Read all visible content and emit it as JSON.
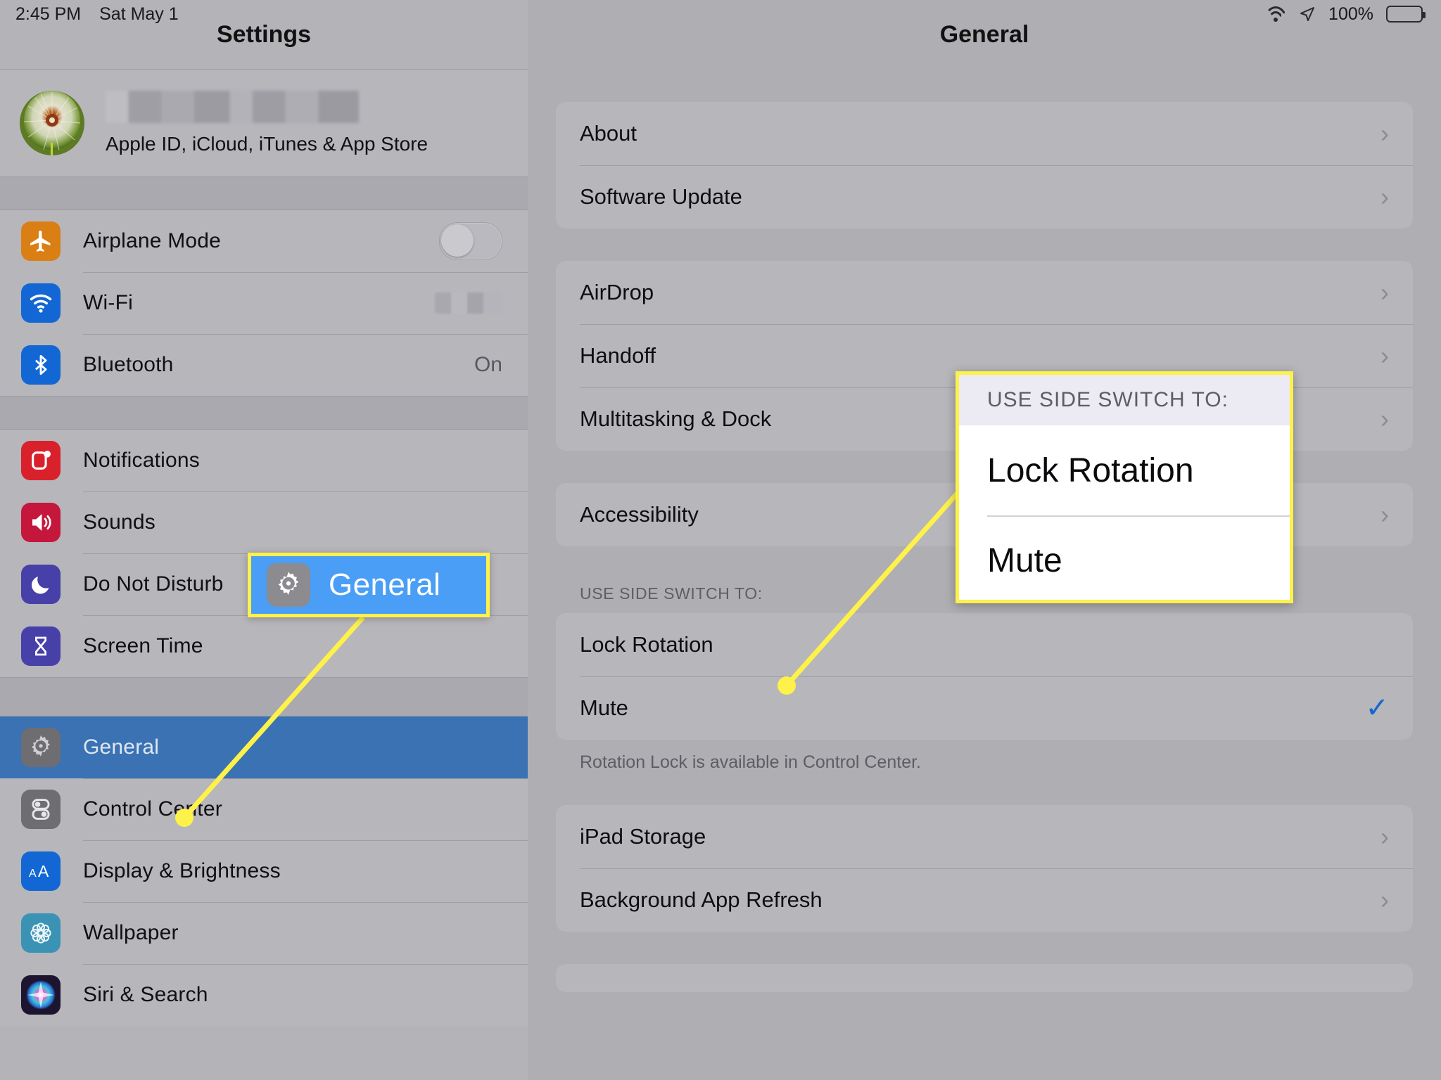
{
  "statusbar": {
    "time": "2:45 PM",
    "date": "Sat May 1",
    "battery_percent": "100%",
    "wifi_icon": "wifi-icon",
    "location_icon": "location-arrow-icon",
    "battery_icon": "battery-full-icon"
  },
  "sidebar": {
    "title": "Settings",
    "account": {
      "name_redacted": "",
      "subtitle": "Apple ID, iCloud, iTunes & App Store",
      "avatar_alt": "dandelion-photo"
    },
    "groups": [
      {
        "items": [
          {
            "label": "Airplane Mode",
            "icon": "airplane-icon",
            "color": "#d97f13",
            "control": "toggle",
            "toggle_on": false
          },
          {
            "label": "Wi-Fi",
            "icon": "wifi-icon",
            "color": "#1267d4",
            "control": "blurred-value"
          },
          {
            "label": "Bluetooth",
            "icon": "bluetooth-icon",
            "color": "#1267d4",
            "control": "value",
            "value": "On"
          }
        ]
      },
      {
        "items": [
          {
            "label": "Notifications",
            "icon": "notifications-icon",
            "color": "#d8212b"
          },
          {
            "label": "Sounds",
            "icon": "speaker-icon",
            "color": "#c5173c"
          },
          {
            "label": "Do Not Disturb",
            "icon": "moon-icon",
            "color": "#4740a8"
          },
          {
            "label": "Screen Time",
            "icon": "hourglass-icon",
            "color": "#4740a8"
          }
        ]
      },
      {
        "items": [
          {
            "label": "General",
            "icon": "gear-icon",
            "color": "#6e6e73",
            "selected": true
          },
          {
            "label": "Control Center",
            "icon": "control-center-icon",
            "color": "#6e6e73"
          },
          {
            "label": "Display & Brightness",
            "icon": "text-size-icon",
            "color": "#1267d4"
          },
          {
            "label": "Wallpaper",
            "icon": "flower-icon",
            "color": "#3a93b5"
          },
          {
            "label": "Siri & Search",
            "icon": "siri-icon",
            "color": "#2a1b3d"
          }
        ]
      }
    ]
  },
  "main": {
    "title": "General",
    "groups": [
      {
        "rows": [
          {
            "label": "About",
            "accessory": "chevron"
          },
          {
            "label": "Software Update",
            "accessory": "chevron"
          }
        ]
      },
      {
        "rows": [
          {
            "label": "AirDrop",
            "accessory": "chevron"
          },
          {
            "label": "Handoff",
            "accessory": "chevron"
          },
          {
            "label": "Multitasking & Dock",
            "accessory": "chevron"
          }
        ]
      },
      {
        "rows": [
          {
            "label": "Accessibility",
            "accessory": "chevron"
          }
        ]
      },
      {
        "header": "USE SIDE SWITCH TO:",
        "footer": "Rotation Lock is available in Control Center.",
        "rows": [
          {
            "label": "Lock Rotation",
            "accessory": "none"
          },
          {
            "label": "Mute",
            "accessory": "check"
          }
        ]
      },
      {
        "rows": [
          {
            "label": "iPad Storage",
            "accessory": "chevron"
          },
          {
            "label": "Background App Refresh",
            "accessory": "chevron"
          }
        ]
      }
    ]
  },
  "callouts": {
    "general": {
      "label": "General",
      "icon": "gear-icon",
      "background": "#4a9ef5",
      "border": "#fdf14a"
    },
    "side_switch": {
      "header": "USE SIDE SWITCH TO:",
      "items": [
        "Lock Rotation",
        "Mute"
      ],
      "border": "#fdf14a"
    },
    "leader_color": "#fdf14a"
  }
}
